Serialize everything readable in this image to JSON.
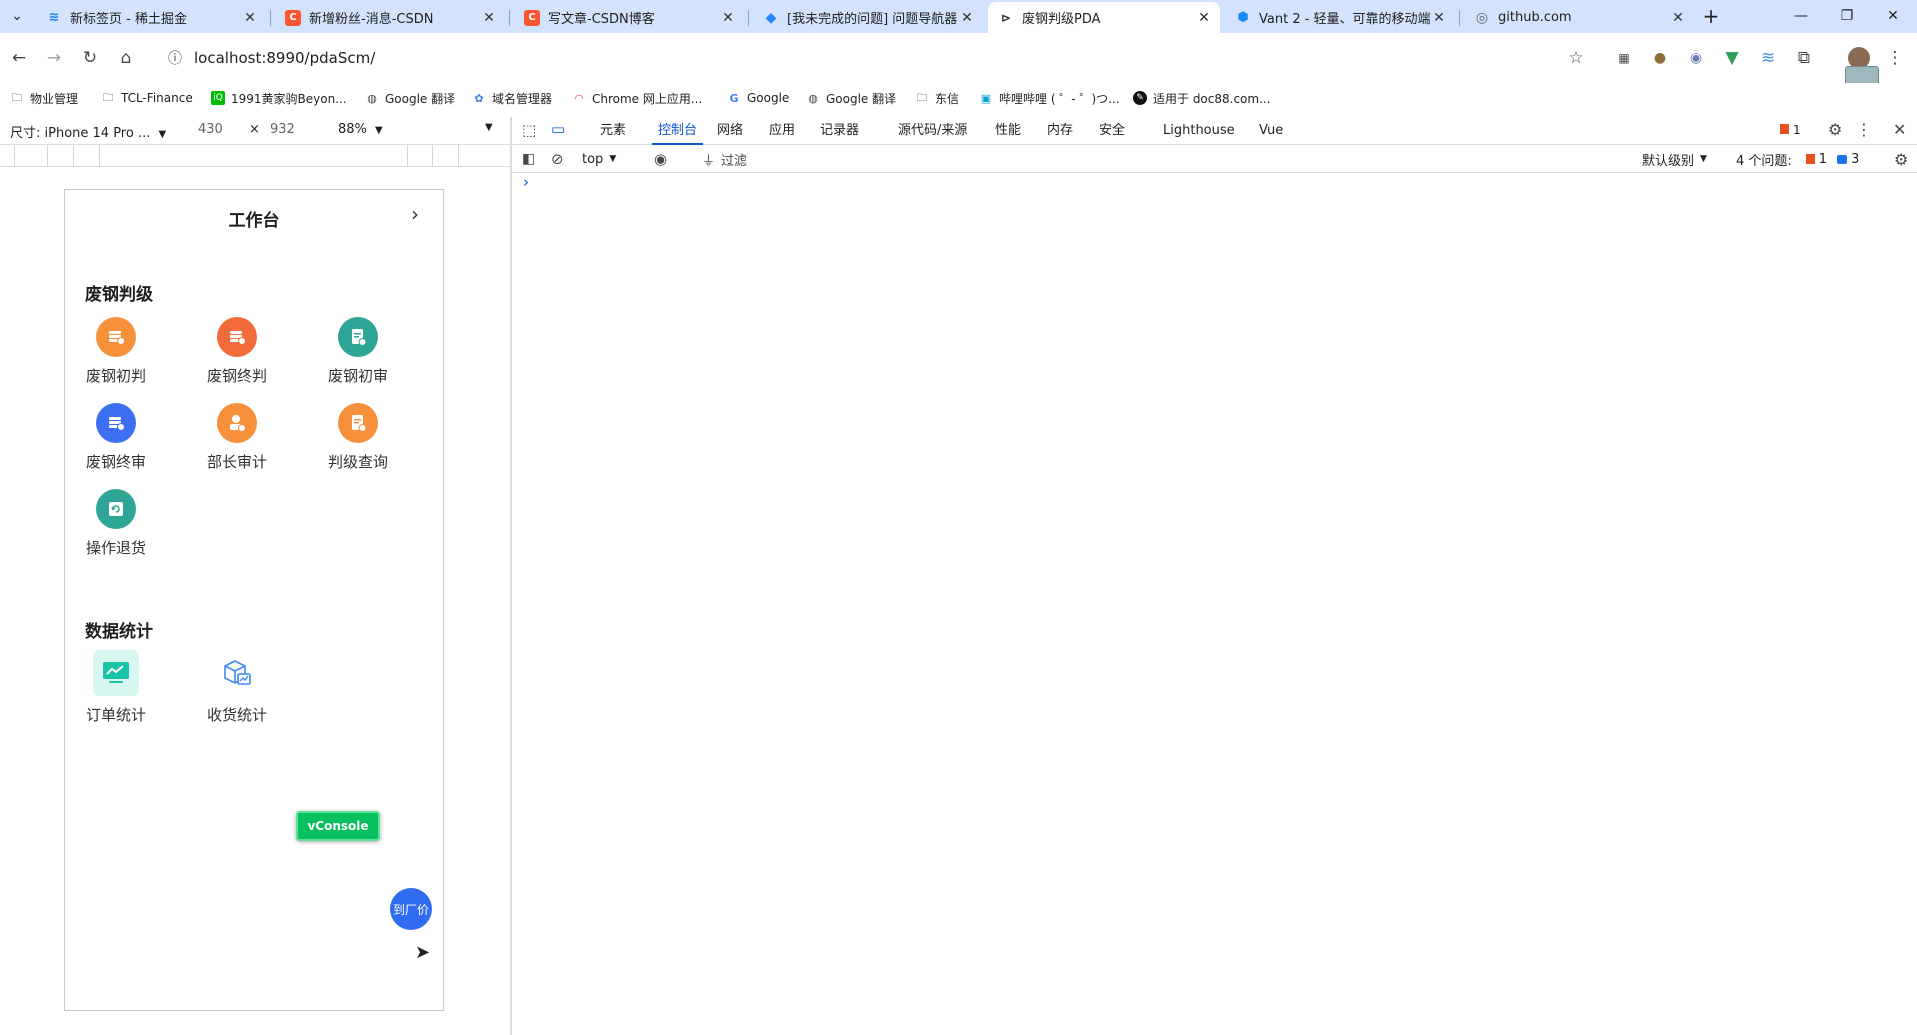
{
  "browser": {
    "tabs": [
      {
        "label": "新标签页 - 稀土掘金",
        "icon": "juejin-icon",
        "color": "#1e80ff"
      },
      {
        "label": "新增粉丝-消息-CSDN",
        "icon": "csdn-icon",
        "color": "#fc5531"
      },
      {
        "label": "写文章-CSDN博客",
        "icon": "csdn-icon",
        "color": "#fc5531"
      },
      {
        "label": "[我未完成的问题] 问题导航器 -",
        "icon": "jira-icon",
        "color": "#2684ff"
      },
      {
        "label": "废钢判级PDA",
        "icon": "page-icon",
        "color": "#333333"
      },
      {
        "label": "Vant 2 - 轻量、可靠的移动端...",
        "icon": "vant-icon",
        "color": "#1989fa"
      },
      {
        "label": "github.com",
        "icon": "globe-icon",
        "color": "#5f6368"
      }
    ],
    "new_tab_symbol": "+",
    "url": "localhost:8990/pdaScm/",
    "bookmarks": [
      {
        "label": "物业管理",
        "icon": "folder-icon"
      },
      {
        "label": "TCL-Finance",
        "icon": "folder-icon"
      },
      {
        "label": "1991黄家驹Beyon...",
        "icon": "iqiyi-icon"
      },
      {
        "label": "Google 翻译",
        "icon": "translate-icon"
      },
      {
        "label": "域名管理器",
        "icon": "domain-icon"
      },
      {
        "label": "Chrome 网上应用...",
        "icon": "chrome-store-icon"
      },
      {
        "label": "Google",
        "icon": "google-icon"
      },
      {
        "label": "Google 翻译",
        "icon": "translate-icon"
      },
      {
        "label": "东信",
        "icon": "folder-icon"
      },
      {
        "label": "哔哩哔哩 ( ゜- ゜)つ...",
        "icon": "bilibili-icon"
      },
      {
        "label": "适用于 doc88.com...",
        "icon": "doc88-icon"
      }
    ]
  },
  "device_toolbar": {
    "device": "尺寸: iPhone 14 Pro ...",
    "width": "430",
    "times": "×",
    "height": "932",
    "zoom": "88%"
  },
  "app": {
    "nav_title": "工作台",
    "sections": [
      {
        "title": "废钢判级",
        "items": [
          {
            "label": "废钢初判",
            "color": "#f7903a"
          },
          {
            "label": "废钢终判",
            "color": "#f26b3a"
          },
          {
            "label": "废钢初审",
            "color": "#2fa596"
          },
          {
            "label": "废钢终审",
            "color": "#3d6ff2"
          },
          {
            "label": "部长审计",
            "color": "#f7903a"
          },
          {
            "label": "判级查询",
            "color": "#f7903a"
          },
          {
            "label": "操作退货",
            "color": "#2fa596"
          }
        ]
      },
      {
        "title": "数据统计",
        "items": [
          {
            "label": "订单统计",
            "color": "#19c3a5"
          },
          {
            "label": "收货统计",
            "color": "#3d8af2"
          }
        ]
      }
    ],
    "vconsole_label": "vConsole",
    "fab_label": "到厂价"
  },
  "devtools": {
    "tabs": [
      "元素",
      "控制台",
      "网络",
      "应用",
      "记录器",
      "源代码/来源",
      "性能",
      "内存",
      "安全",
      "Lighthouse",
      "Vue"
    ],
    "active_tab": "控制台",
    "error_badge": "1",
    "context": "top",
    "filter_label": "过滤",
    "level": "默认级别",
    "issues_label": "4 个问题:",
    "issues_errors": "1",
    "issues_info": "3",
    "prompt": "›"
  }
}
